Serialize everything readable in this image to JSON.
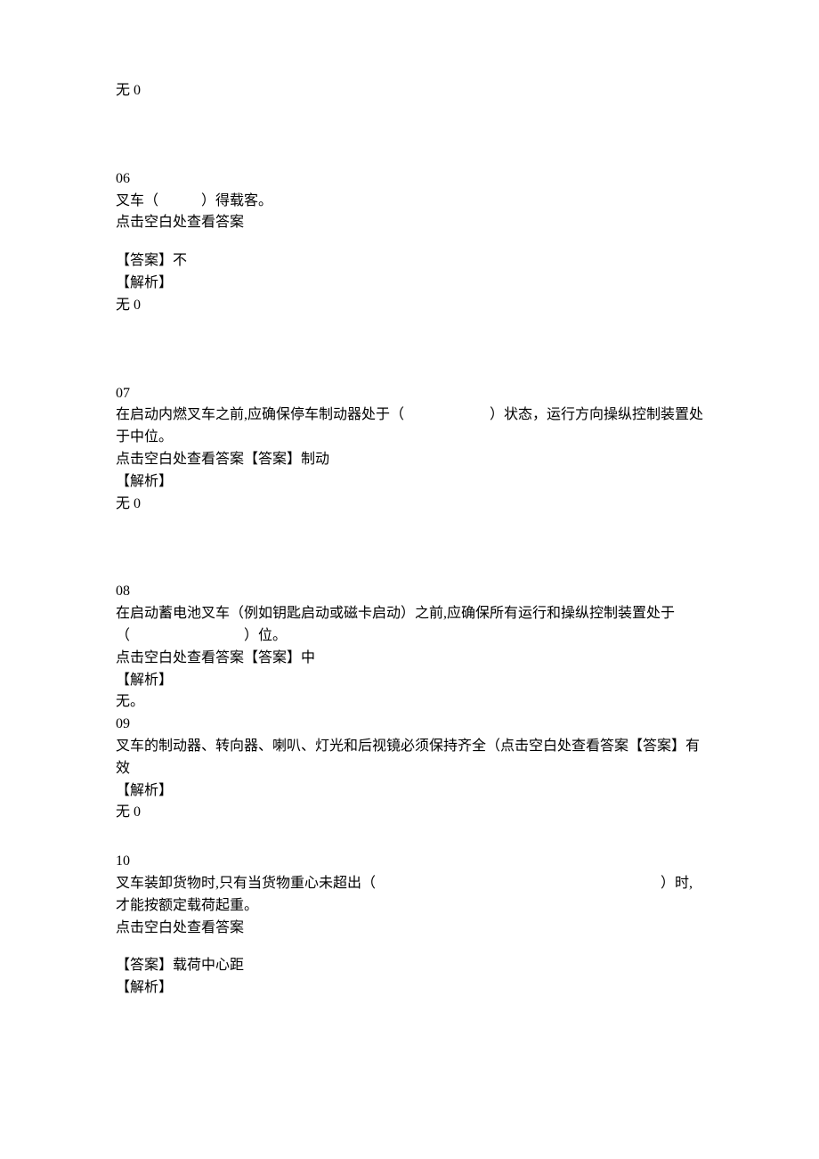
{
  "q05": {
    "explain_none": "无 0"
  },
  "q06": {
    "num": "06",
    "question": "叉车（　　　）得载客。",
    "hint": "点击空白处查看答案",
    "answer": "【答案】不",
    "explain_label": "【解析】",
    "explain_none": "无 0"
  },
  "q07": {
    "num": "07",
    "question": "在启动内燃叉车之前,应确保停车制动器处于（　　　　　　）状态，运行方向操纵控制装置处于中位。",
    "hint_and_answer": "点击空白处查看答案【答案】制动",
    "explain_label": "【解析】",
    "explain_none": "无 0"
  },
  "q08": {
    "num": "08",
    "question": "在启动蓄电池叉车（例如钥匙启动或磁卡启动）之前,应确保所有运行和操纵控制装置处于（　　　　　　　　）位。",
    "hint_and_answer": "点击空白处查看答案【答案】中",
    "explain_label": "【解析】",
    "explain_none": "无。"
  },
  "q09": {
    "num": "09",
    "question_and_answer": "叉车的制动器、转向器、喇叭、灯光和后视镜必须保持齐全（点击空白处查看答案【答案】有效",
    "explain_label": "【解析】",
    "explain_none": "无 0"
  },
  "q10": {
    "num": "10",
    "question": "叉车装卸货物时,只有当货物重心未超出（　　　　　　　　　　　　　　　　　　　　）时,才能按额定载荷起重。",
    "hint": "点击空白处查看答案",
    "answer": "【答案】载荷中心距",
    "explain_label": "【解析】"
  }
}
